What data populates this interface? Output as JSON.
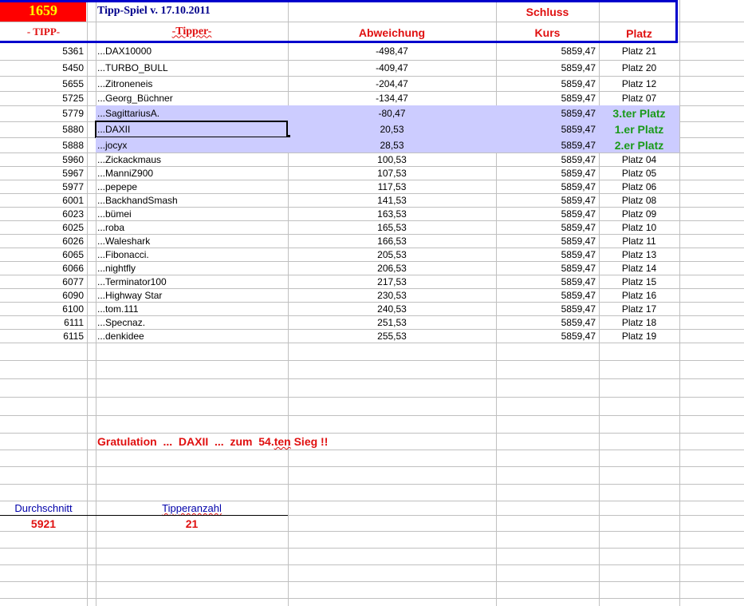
{
  "header": {
    "number": "1659",
    "title": "Tipp-Spiel v. 17.10.2011",
    "schluss": "Schluss",
    "col_tipp": "- TIPP-",
    "col_tipper": "-Tipper-",
    "col_abweichung": "Abweichung",
    "col_kurs": "Kurs",
    "col_platz": "Platz"
  },
  "colors": {
    "red_cell": "#ff0000",
    "number": "#ffff00",
    "title": "#00008b",
    "accent_red": "#e01010",
    "highlight": "#ccccff",
    "winner_green": "#1a9a1a",
    "border_blue": "#0000cc"
  },
  "rows": [
    {
      "tipp": "5361",
      "tipper": "...DAX10000",
      "abw": "-498,47",
      "kurs": "5859,47",
      "platz": "Platz 21"
    },
    {
      "tipp": "5450",
      "tipper": "...TURBO_BULL",
      "abw": "-409,47",
      "kurs": "5859,47",
      "platz": "Platz 20"
    },
    {
      "tipp": "5655",
      "tipper": "...Zitroneneis",
      "abw": "-204,47",
      "kurs": "5859,47",
      "platz": "Platz 12"
    },
    {
      "tipp": "5725",
      "tipper": "...Georg_Büchner",
      "abw": "-134,47",
      "kurs": "5859,47",
      "platz": "Platz 07"
    },
    {
      "tipp": "5779",
      "tipper": "...SagittariusA.",
      "abw": "-80,47",
      "kurs": "5859,47",
      "platz": "3.ter Platz",
      "winner": true
    },
    {
      "tipp": "5880",
      "tipper": "...DAXII",
      "abw": "20,53",
      "kurs": "5859,47",
      "platz": "1.er Platz",
      "winner": true,
      "selected": true
    },
    {
      "tipp": "5888",
      "tipper": "...jocyx",
      "abw": "28,53",
      "kurs": "5859,47",
      "platz": "2.er Platz",
      "winner": true
    },
    {
      "tipp": "5960",
      "tipper": "...Zickackmaus",
      "abw": "100,53",
      "kurs": "5859,47",
      "platz": "Platz 04"
    },
    {
      "tipp": "5967",
      "tipper": "...ManniZ900",
      "abw": "107,53",
      "kurs": "5859,47",
      "platz": "Platz 05"
    },
    {
      "tipp": "5977",
      "tipper": "...pepepe",
      "abw": "117,53",
      "kurs": "5859,47",
      "platz": "Platz 06"
    },
    {
      "tipp": "6001",
      "tipper": "...BackhandSmash",
      "abw": "141,53",
      "kurs": "5859,47",
      "platz": "Platz 08"
    },
    {
      "tipp": "6023",
      "tipper": "...bümei",
      "abw": "163,53",
      "kurs": "5859,47",
      "platz": "Platz 09"
    },
    {
      "tipp": "6025",
      "tipper": "...roba",
      "abw": "165,53",
      "kurs": "5859,47",
      "platz": "Platz 10"
    },
    {
      "tipp": "6026",
      "tipper": "...Waleshark",
      "abw": "166,53",
      "kurs": "5859,47",
      "platz": "Platz 11"
    },
    {
      "tipp": "6065",
      "tipper": "...Fibonacci.",
      "abw": "205,53",
      "kurs": "5859,47",
      "platz": "Platz 13"
    },
    {
      "tipp": "6066",
      "tipper": "...nightfly",
      "abw": "206,53",
      "kurs": "5859,47",
      "platz": "Platz 14"
    },
    {
      "tipp": "6077",
      "tipper": "...Terminator100",
      "abw": "217,53",
      "kurs": "5859,47",
      "platz": "Platz 15"
    },
    {
      "tipp": "6090",
      "tipper": "...Highway Star",
      "abw": "230,53",
      "kurs": "5859,47",
      "platz": "Platz 16"
    },
    {
      "tipp": "6100",
      "tipper": "...tom.111",
      "abw": "240,53",
      "kurs": "5859,47",
      "platz": "Platz 17"
    },
    {
      "tipp": "6111",
      "tipper": "...Specnaz.",
      "abw": "251,53",
      "kurs": "5859,47",
      "platz": "Platz 18"
    },
    {
      "tipp": "6115",
      "tipper": "...denkidee",
      "abw": "255,53",
      "kurs": "5859,47",
      "platz": "Platz 19"
    }
  ],
  "footer": {
    "gratulation_pre": "Gratulation  ...  DAXII  ...  zum  54.",
    "gratulation_squig": "ten",
    "gratulation_post": " Sieg !!",
    "durchschnitt_label": "Durchschnitt",
    "durchschnitt_value": "5921",
    "tipperanzahl_label": "Tipperanzahl",
    "tipperanzahl_value": "21"
  }
}
